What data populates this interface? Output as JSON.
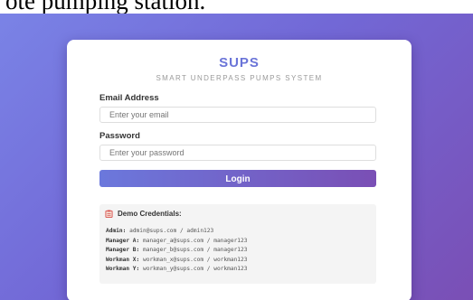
{
  "caption": "ote pumping station.",
  "app": {
    "name": "SUPS",
    "tagline": "SMART UNDERPASS PUMPS SYSTEM"
  },
  "form": {
    "email_label": "Email Address",
    "email_placeholder": "Enter your email",
    "password_label": "Password",
    "password_placeholder": "Enter your password",
    "login_label": "Login"
  },
  "demo": {
    "icon": "clipboard-icon",
    "title": "Demo Credentials:",
    "credentials": [
      {
        "role": "Admin:",
        "login": "admin@sups.com / admin123"
      },
      {
        "role": "Manager A:",
        "login": "manager_a@sups.com / manager123"
      },
      {
        "role": "Manager B:",
        "login": "manager_b@sups.com / manager123"
      },
      {
        "role": "Workman X:",
        "login": "workman_x@sups.com / workman123"
      },
      {
        "role": "Workman Y:",
        "login": "workman_y@sups.com / workman123"
      }
    ]
  },
  "colors": {
    "brand": "#6a74d8",
    "gradient_start": "#7a83e6",
    "gradient_end": "#7a4fb5",
    "button_start": "#6b78dc",
    "button_end": "#7a4fb5"
  }
}
